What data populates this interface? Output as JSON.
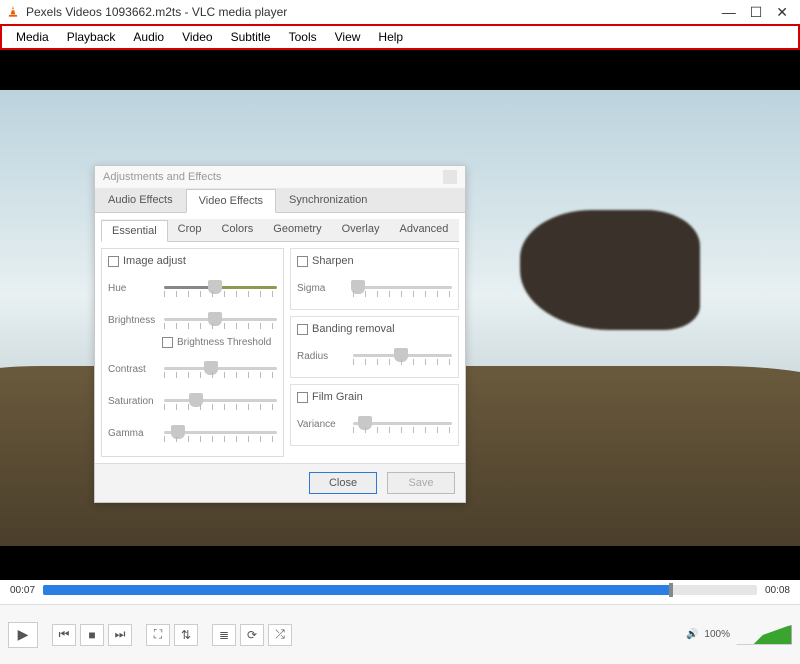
{
  "title": "Pexels Videos 1093662.m2ts - VLC media player",
  "menu": [
    "Media",
    "Playback",
    "Audio",
    "Video",
    "Subtitle",
    "Tools",
    "View",
    "Help"
  ],
  "dialog": {
    "title": "Adjustments and Effects",
    "tabs_main": [
      "Audio Effects",
      "Video Effects",
      "Synchronization"
    ],
    "tab_main_active": 1,
    "tabs_sub": [
      "Essential",
      "Crop",
      "Colors",
      "Geometry",
      "Overlay",
      "Advanced"
    ],
    "tab_sub_active": 0,
    "left": {
      "group_label": "Image adjust",
      "hue": {
        "label": "Hue",
        "pos": 0.45
      },
      "brightness": {
        "label": "Brightness",
        "pos": 0.45
      },
      "brightness_threshold": "Brightness Threshold",
      "contrast": {
        "label": "Contrast",
        "pos": 0.42
      },
      "saturation": {
        "label": "Saturation",
        "pos": 0.28
      },
      "gamma": {
        "label": "Gamma",
        "pos": 0.12
      }
    },
    "right": {
      "sharpen": {
        "group": "Sharpen",
        "sigma_label": "Sigma",
        "sigma_pos": 0.05
      },
      "banding": {
        "group": "Banding removal",
        "radius_label": "Radius",
        "radius_pos": 0.48
      },
      "grain": {
        "group": "Film Grain",
        "variance_label": "Variance",
        "variance_pos": 0.12
      }
    },
    "buttons": {
      "close": "Close",
      "save": "Save"
    }
  },
  "time": {
    "current": "00:07",
    "total": "00:08",
    "progress": 0.88
  },
  "volume": {
    "label": "100%"
  }
}
